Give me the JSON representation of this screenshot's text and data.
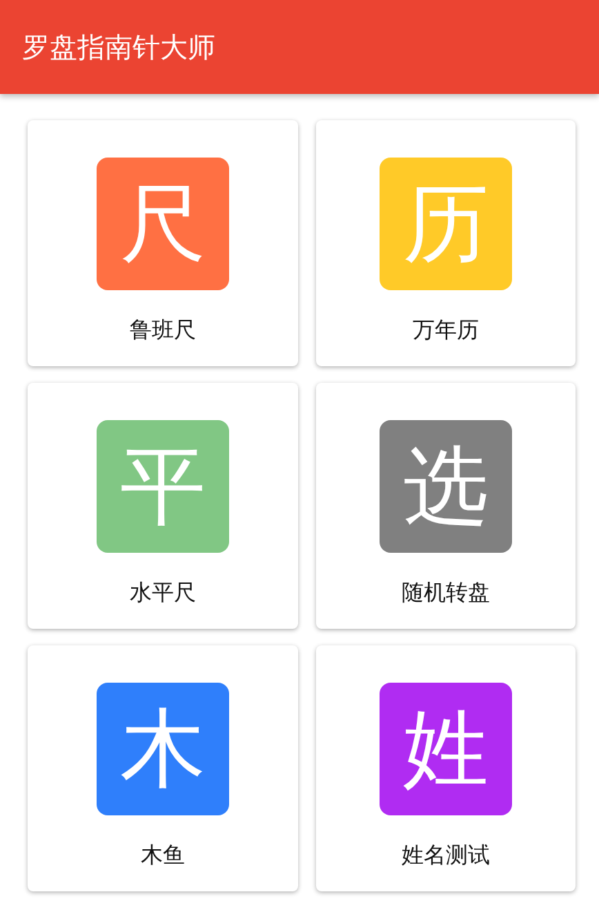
{
  "app_bar": {
    "title": "罗盘指南针大师"
  },
  "tools": [
    {
      "glyph": "尺",
      "label": "鲁班尺",
      "color": "#ff7043"
    },
    {
      "glyph": "历",
      "label": "万年历",
      "color": "#ffca28"
    },
    {
      "glyph": "平",
      "label": "水平尺",
      "color": "#81c784"
    },
    {
      "glyph": "选",
      "label": "随机转盘",
      "color": "#808080"
    },
    {
      "glyph": "木",
      "label": "木鱼",
      "color": "#2f7ffb"
    },
    {
      "glyph": "姓",
      "label": "姓名测试",
      "color": "#b02cf2"
    }
  ]
}
